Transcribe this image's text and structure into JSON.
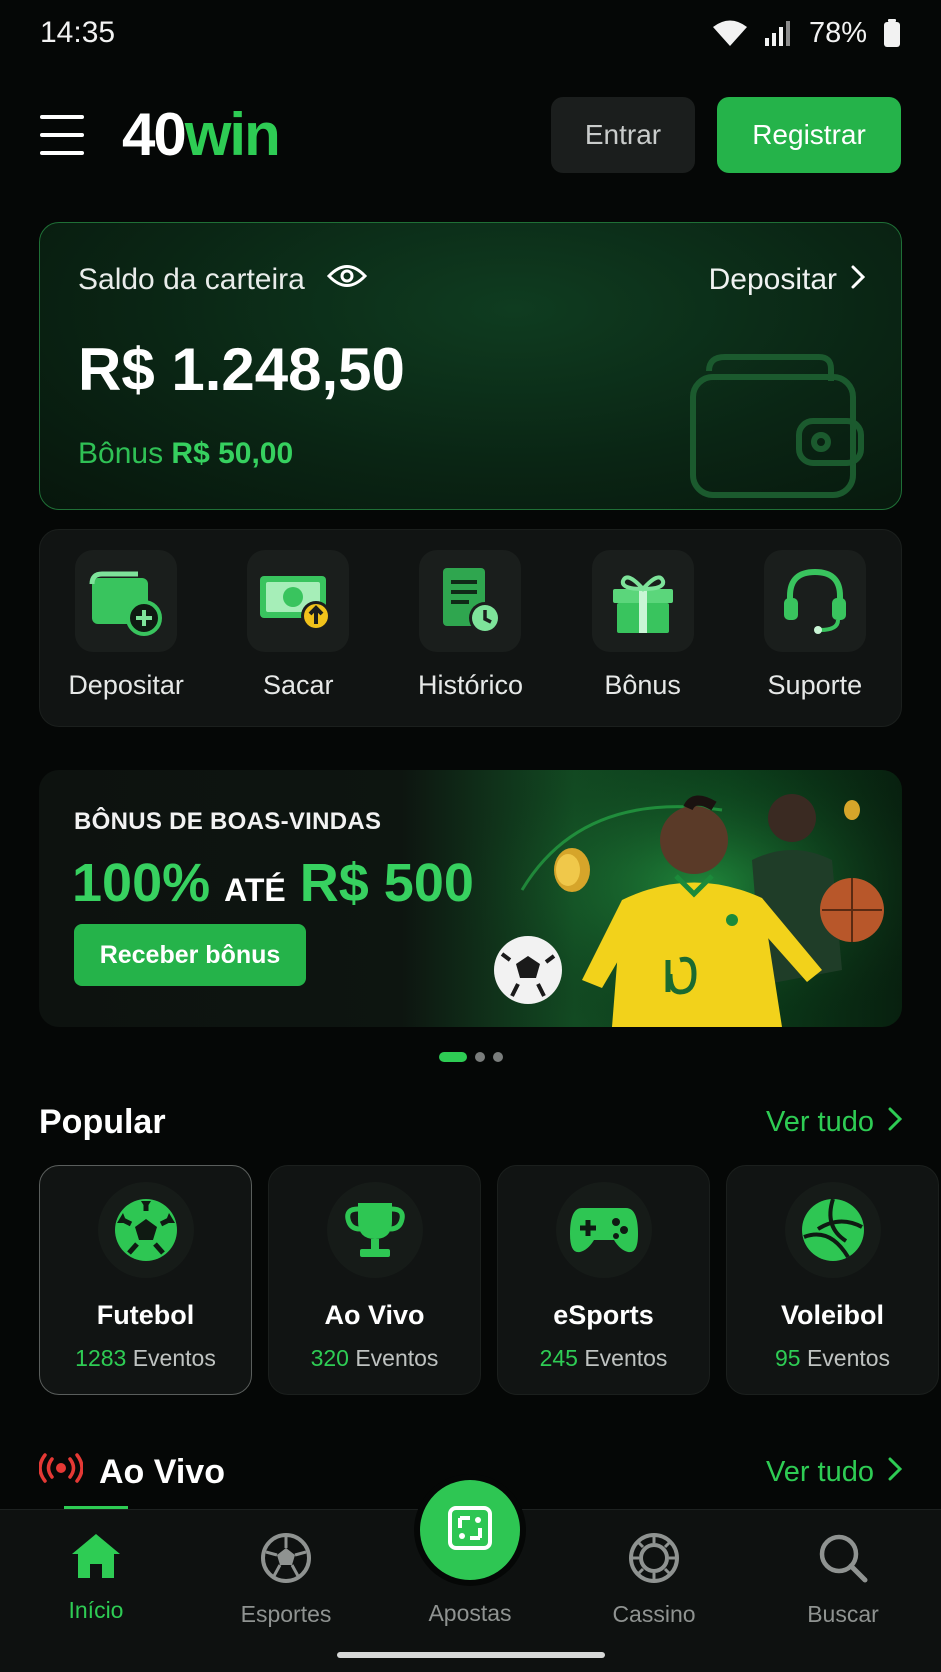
{
  "status_bar": {
    "time": "14:35",
    "battery": "78%"
  },
  "header": {
    "logo_part1": "40",
    "logo_part2": "win",
    "login_label": "Entrar",
    "register_label": "Registrar"
  },
  "wallet": {
    "label": "Saldo da carteira",
    "deposit_link": "Depositar",
    "balance": "R$ 1.248,50",
    "bonus_label": "Bônus",
    "bonus_value": "R$ 50,00"
  },
  "quick_actions": [
    {
      "label": "Depositar",
      "icon": "wallet-plus-icon"
    },
    {
      "label": "Sacar",
      "icon": "cash-withdraw-icon"
    },
    {
      "label": "Histórico",
      "icon": "history-icon"
    },
    {
      "label": "Bônus",
      "icon": "gift-icon"
    },
    {
      "label": "Suporte",
      "icon": "headset-icon"
    }
  ],
  "promo": {
    "kicker": "BÔNUS DE BOAS-VINDAS",
    "percent": "100%",
    "ate": "ATÉ",
    "amount": "R$ 500",
    "button": "Receber bônus",
    "slides_total": 3,
    "slide_active": 1
  },
  "popular": {
    "title": "Popular",
    "see_all": "Ver tudo",
    "items": [
      {
        "name": "Futebol",
        "count": "1283",
        "suffix": "Eventos",
        "icon": "soccer-ball-icon"
      },
      {
        "name": "Ao Vivo",
        "count": "320",
        "suffix": "Eventos",
        "icon": "trophy-icon"
      },
      {
        "name": "eSports",
        "count": "245",
        "suffix": "Eventos",
        "icon": "gamepad-icon"
      },
      {
        "name": "Voleibol",
        "count": "95",
        "suffix": "Eventos",
        "icon": "volleyball-icon"
      }
    ]
  },
  "live": {
    "title": "Ao Vivo",
    "see_all": "Ver tudo"
  },
  "bottom_nav": {
    "items": [
      {
        "label": "Início",
        "icon": "home-icon",
        "active": true
      },
      {
        "label": "Esportes",
        "icon": "soccer-ball-icon",
        "active": false
      },
      {
        "label": "Apostas",
        "icon": "bet-slip-icon",
        "active": false
      },
      {
        "label": "Cassino",
        "icon": "casino-chip-icon",
        "active": false
      },
      {
        "label": "Buscar",
        "icon": "search-icon",
        "active": false
      }
    ]
  },
  "colors": {
    "accent": "#2ecc54",
    "background": "#050706",
    "card": "#111413",
    "live_red": "#e53935"
  }
}
